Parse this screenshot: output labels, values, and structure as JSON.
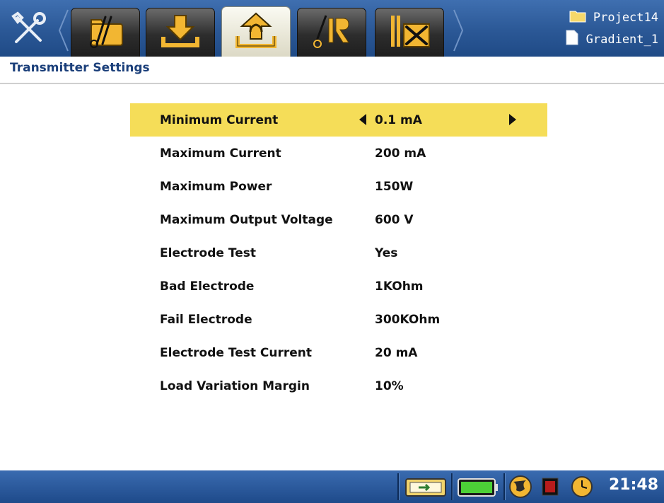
{
  "colors": {
    "topbar": "#2b5896",
    "title": "#1b3f7a",
    "highlight": "#f5dd58",
    "statusbar": "#1e4a8a",
    "icon_yellow": "#f2b632"
  },
  "toolbar": {
    "left_icon": "tools-icon",
    "tabs": [
      {
        "icon": "project-folder-icon",
        "active": false
      },
      {
        "icon": "download-icon",
        "active": false
      },
      {
        "icon": "upload-icon",
        "active": true
      },
      {
        "icon": "ip-measurement-icon",
        "active": false
      },
      {
        "icon": "equipment-tools-icon",
        "active": false
      }
    ]
  },
  "project": {
    "name": "Project14",
    "file": "Gradient_1",
    "folder_icon": "folder-icon",
    "file_icon": "file-icon"
  },
  "page": {
    "title": "Transmitter Settings"
  },
  "settings": [
    {
      "label": "Minimum Current",
      "value": "0.1 mA",
      "selected": true
    },
    {
      "label": "Maximum Current",
      "value": "200 mA"
    },
    {
      "label": "Maximum Power",
      "value": "150W"
    },
    {
      "label": "Maximum Output Voltage",
      "value": "600 V"
    },
    {
      "label": "Electrode Test",
      "value": "Yes"
    },
    {
      "label": "Bad Electrode",
      "value": "1KOhm"
    },
    {
      "label": "Fail Electrode",
      "value": "300KOhm"
    },
    {
      "label": "Electrode Test Current",
      "value": "20 mA"
    },
    {
      "label": "Load Variation Margin",
      "value": "10%"
    }
  ],
  "statusbar": {
    "icons": [
      "external-power-icon",
      "battery-icon",
      "gps-globe-icon",
      "record-indicator-icon",
      "clock-icon"
    ],
    "time": "21:48"
  }
}
